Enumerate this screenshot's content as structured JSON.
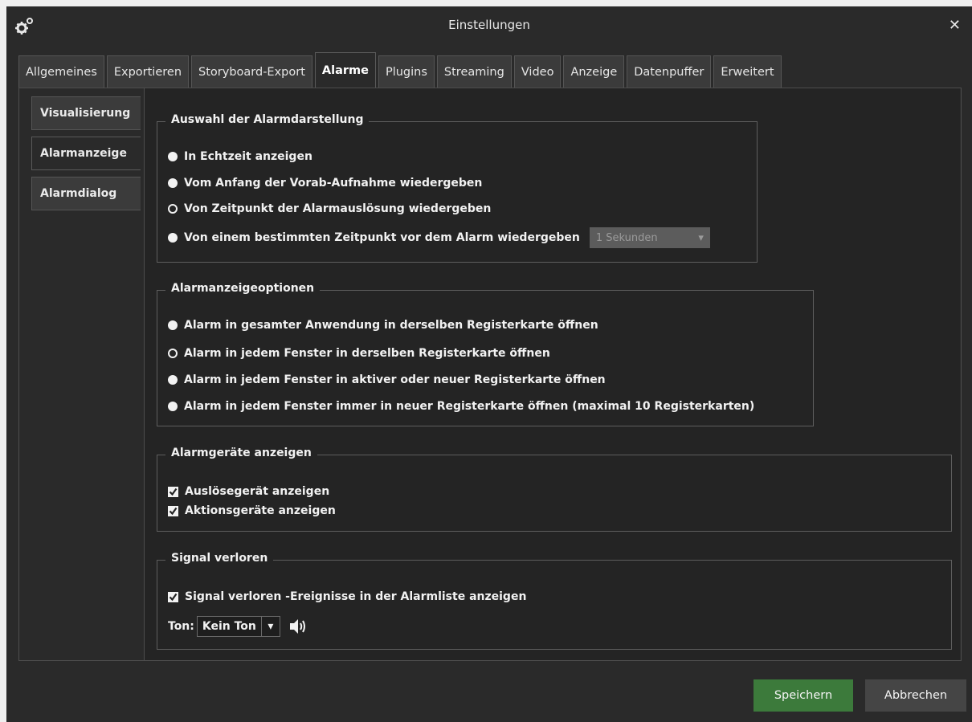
{
  "window": {
    "title": "Einstellungen"
  },
  "tabs": [
    {
      "label": "Allgemeines"
    },
    {
      "label": "Exportieren"
    },
    {
      "label": "Storyboard-Export"
    },
    {
      "label": "Alarme"
    },
    {
      "label": "Plugins"
    },
    {
      "label": "Streaming"
    },
    {
      "label": "Video"
    },
    {
      "label": "Anzeige"
    },
    {
      "label": "Datenpuffer"
    },
    {
      "label": "Erweitert"
    }
  ],
  "active_tab": "Alarme",
  "sidetabs": [
    {
      "label": "Visualisierung"
    },
    {
      "label": "Alarmanzeige"
    },
    {
      "label": "Alarmdialog"
    }
  ],
  "active_sidetab": "Alarmanzeige",
  "group1": {
    "title": "Auswahl der Alarmdarstellung",
    "options": [
      {
        "label": "In Echtzeit anzeigen",
        "selected": false
      },
      {
        "label": "Vom Anfang der Vorab-Aufnahme wiedergeben",
        "selected": false
      },
      {
        "label": "Von Zeitpunkt der Alarmauslösung wiedergeben",
        "selected": true
      },
      {
        "label": "Von einem bestimmten Zeitpunkt vor dem Alarm wiedergeben",
        "selected": false
      }
    ],
    "seconds_value": "1 Sekunden"
  },
  "group2": {
    "title": "Alarmanzeigeoptionen",
    "options": [
      {
        "label": "Alarm in gesamter Anwendung in derselben Registerkarte öffnen",
        "selected": false
      },
      {
        "label": "Alarm in jedem Fenster in derselben Registerkarte öffnen",
        "selected": true
      },
      {
        "label": "Alarm in jedem Fenster in aktiver oder neuer Registerkarte öffnen",
        "selected": false
      },
      {
        "label": "Alarm in jedem Fenster immer in neuer Registerkarte öffnen (maximal 10 Registerkarten)",
        "selected": false
      }
    ]
  },
  "group3": {
    "title": "Alarmgeräte anzeigen",
    "checks": [
      {
        "label": "Auslösegerät anzeigen",
        "checked": true
      },
      {
        "label": "Aktionsgeräte anzeigen",
        "checked": true
      }
    ]
  },
  "group4": {
    "title": "Signal verloren",
    "check": {
      "label": "Signal verloren -Ereignisse in der Alarmliste anzeigen",
      "checked": true
    },
    "tone_label": "Ton:",
    "tone_value": "Kein Ton"
  },
  "buttons": {
    "save": "Speichern",
    "cancel": "Abbrechen"
  },
  "colors": {
    "save_button": "#3c7a3b",
    "background": "#2a2a2a"
  }
}
